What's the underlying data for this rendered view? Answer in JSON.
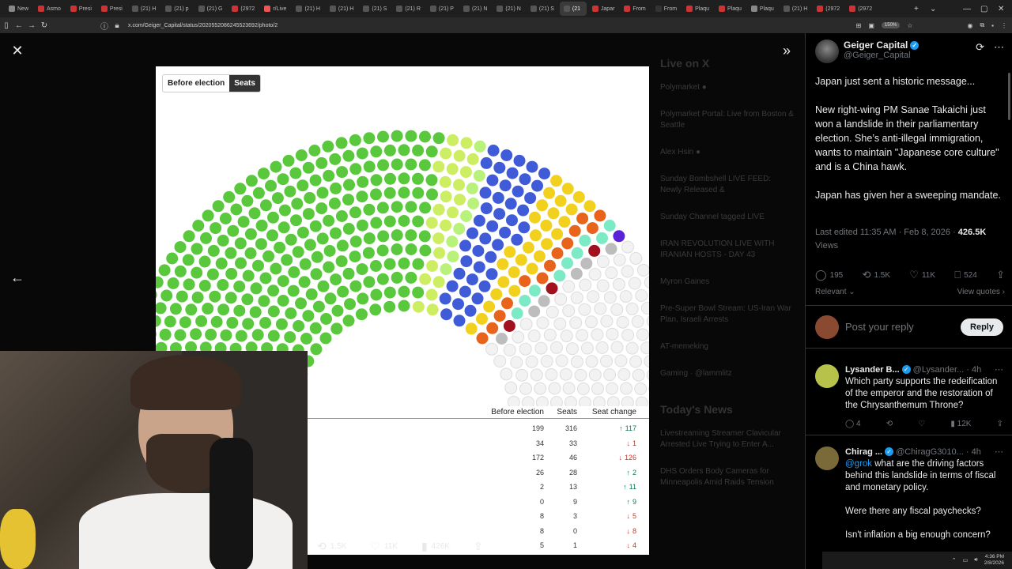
{
  "browser": {
    "tabs": [
      {
        "label": "New",
        "fav": "#888"
      },
      {
        "label": "Asmo",
        "fav": "#c33"
      },
      {
        "label": "Presi",
        "fav": "#c33"
      },
      {
        "label": "Presi",
        "fav": "#c33"
      },
      {
        "label": "(21) H",
        "fav": "#555"
      },
      {
        "label": "(21) p",
        "fav": "#555"
      },
      {
        "label": "(21) G",
        "fav": "#555"
      },
      {
        "label": "(2972",
        "fav": "#c33"
      },
      {
        "label": "r/Live",
        "fav": "#e55"
      },
      {
        "label": "(21) H",
        "fav": "#555"
      },
      {
        "label": "(21) H",
        "fav": "#555"
      },
      {
        "label": "(21) S",
        "fav": "#555"
      },
      {
        "label": "(21) R",
        "fav": "#555"
      },
      {
        "label": "(21) P",
        "fav": "#555"
      },
      {
        "label": "(21) N",
        "fav": "#555"
      },
      {
        "label": "(21) N",
        "fav": "#555"
      },
      {
        "label": "(21) S",
        "fav": "#555"
      },
      {
        "label": "(21",
        "fav": "#555",
        "active": true
      },
      {
        "label": "Japar",
        "fav": "#c33"
      },
      {
        "label": "From",
        "fav": "#c33"
      },
      {
        "label": "From",
        "fav": "#333"
      },
      {
        "label": "Plaqu",
        "fav": "#c33"
      },
      {
        "label": "Plaqu",
        "fav": "#c33"
      },
      {
        "label": "Plaqu",
        "fav": "#888"
      },
      {
        "label": "(21) H",
        "fav": "#555"
      },
      {
        "label": "(2972",
        "fav": "#c33"
      },
      {
        "label": "(2972",
        "fav": "#c33"
      }
    ],
    "url": "x.com/Geiger_Capital/status/2020552086245523692/photo/2",
    "zoom": "150%"
  },
  "viewer": {
    "toggle": {
      "before": "Before election",
      "seats": "Seats"
    },
    "background_trending": {
      "heading": "Live on X",
      "items": [
        "Polymarket ●",
        "Polymarket Portal: Live from Boston & Seattle",
        "Alex Hsin ●",
        "Sunday Bombshell LIVE FEED: Newly Released &",
        "Sunday Channel tagged LIVE",
        "IRAN REVOLUTION LIVE WITH IRANIAN HOSTS - DAY 43",
        "Myron Gaines",
        "Pre-Super Bowl Stream: US-Iran War Plan, Israeli Arrests",
        "AT-memeking",
        "Gaming · @lammlitz"
      ],
      "news_heading": "Today's News",
      "news": [
        "Livestreaming Streamer Clavicular Arrested Live Trying to Enter A...",
        "DHS Orders Body Cameras for Minneapolis Amid Raids Tension"
      ]
    },
    "table": {
      "headers": {
        "before": "Before election",
        "seats": "Seats",
        "change": "Seat change"
      },
      "rows": [
        {
          "before": "199",
          "seats": "316",
          "arrow": "↑",
          "change": "117",
          "dir": "up"
        },
        {
          "before": "34",
          "seats": "33",
          "arrow": "↓",
          "change": "1",
          "dir": "down"
        },
        {
          "before": "172",
          "seats": "46",
          "arrow": "↓",
          "change": "126",
          "dir": "down"
        },
        {
          "before": "26",
          "seats": "28",
          "arrow": "↑",
          "change": "2",
          "dir": "up"
        },
        {
          "before": "2",
          "seats": "13",
          "arrow": "↑",
          "change": "11",
          "dir": "up"
        },
        {
          "before": "0",
          "seats": "9",
          "arrow": "↑",
          "change": "9",
          "dir": "up"
        },
        {
          "before": "8",
          "seats": "3",
          "arrow": "↓",
          "change": "5",
          "dir": "down"
        },
        {
          "before": "8",
          "seats": "0",
          "arrow": "↓",
          "change": "8",
          "dir": "down"
        },
        {
          "before": "5",
          "seats": "1",
          "arrow": "↓",
          "change": "4",
          "dir": "down"
        }
      ]
    },
    "parliament": {
      "colors": [
        "#5ac83c",
        "#cdee62",
        "#b8f27a",
        "#3f5bd8",
        "#f2d11e",
        "#e8641d",
        "#7deac6",
        "#a1111e",
        "#5a22d8",
        "#bdbdbd",
        "#f2f2f2"
      ],
      "counts": [
        316,
        24,
        9,
        46,
        28,
        13,
        9,
        3,
        1,
        6,
        10
      ]
    },
    "stats": {
      "reposts": "1.5K",
      "likes": "11K",
      "views": "426K"
    }
  },
  "tweet": {
    "name": "Geiger Capital",
    "handle": "@Geiger_Capital",
    "paragraphs": [
      "Japan just sent a historic message...",
      "New right-wing PM Sanae Takaichi just won a landslide in their parliamentary election. She’s anti-illegal immigration, wants to maintain \"Japanese core culture\" and is a China hawk.",
      "Japan has given her a sweeping mandate."
    ],
    "edited": "Last edited 11:35 AM · Feb 8, 2026 · ",
    "views_count": "426.5K",
    "views_label": "Views",
    "actions": {
      "replies": "195",
      "reposts": "1.5K",
      "likes": "11K",
      "bookmarks": "524"
    },
    "relevant": "Relevant ⌄",
    "view_quotes": "View quotes ›",
    "reply_placeholder": "Post your reply",
    "reply_button": "Reply"
  },
  "comments": [
    {
      "name": "Lysander B...",
      "handle": "@Lysander... · 4h",
      "text": "Which party supports the redeification of the emperor and the restoration of the Chrysanthemum Throne?",
      "replies": "4",
      "reposts": "",
      "likes": "",
      "views": "12K"
    },
    {
      "name": "Chirag ...",
      "handle": "@ChiragG3010... · 4h",
      "mention": "@grok",
      "text": " what are the driving factors behind this landslide in terms of fiscal and monetary policy.",
      "text2": "Were there any fiscal paychecks?",
      "text3": "Isn't inflation a big enough concern?"
    }
  ],
  "taskbar": {
    "time": "4:36 PM",
    "date": "2/8/2026"
  }
}
